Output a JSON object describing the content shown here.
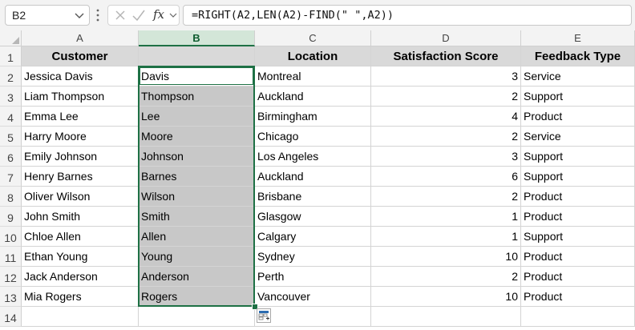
{
  "formula_bar": {
    "name_box": "B2",
    "fx_label": "fx",
    "formula": "=RIGHT(A2,LEN(A2)-FIND(\" \",A2))"
  },
  "columns": [
    "A",
    "B",
    "C",
    "D",
    "E"
  ],
  "row_numbers": [
    "1",
    "2",
    "3",
    "4",
    "5",
    "6",
    "7",
    "8",
    "9",
    "10",
    "11",
    "12",
    "13",
    "14"
  ],
  "headers": [
    "Customer",
    "",
    "Location",
    "Satisfaction Score",
    "Feedback Type"
  ],
  "rows": [
    [
      "Jessica Davis",
      "Davis",
      "Montreal",
      "3",
      "Service"
    ],
    [
      "Liam Thompson",
      "Thompson",
      "Auckland",
      "2",
      "Support"
    ],
    [
      "Emma Lee",
      "Lee",
      "Birmingham",
      "4",
      "Product"
    ],
    [
      "Harry Moore",
      "Moore",
      "Chicago",
      "2",
      "Service"
    ],
    [
      "Emily Johnson",
      "Johnson",
      "Los Angeles",
      "3",
      "Support"
    ],
    [
      "Henry Barnes",
      "Barnes",
      "Auckland",
      "6",
      "Support"
    ],
    [
      "Oliver Wilson",
      "Wilson",
      "Brisbane",
      "2",
      "Product"
    ],
    [
      "John Smith",
      "Smith",
      "Glasgow",
      "1",
      "Product"
    ],
    [
      "Chloe Allen",
      "Allen",
      "Calgary",
      "1",
      "Support"
    ],
    [
      "Ethan Young",
      "Young",
      "Sydney",
      "10",
      "Product"
    ],
    [
      "Jack Anderson",
      "Anderson",
      "Perth",
      "2",
      "Product"
    ],
    [
      "Mia Rogers",
      "Rogers",
      "Vancouver",
      "10",
      "Product"
    ]
  ],
  "selection": {
    "active_cell": "B2",
    "range": "B2:B13",
    "selected_column": "B"
  },
  "colors": {
    "accent_green": "#1e7145",
    "header_fill": "#d9d9d9",
    "selection_fill": "#c8c8c8"
  },
  "icons": [
    "chevron-down-icon",
    "more-options-icon",
    "cancel-icon",
    "enter-icon",
    "insert-function-icon",
    "quick-analysis-icon"
  ]
}
